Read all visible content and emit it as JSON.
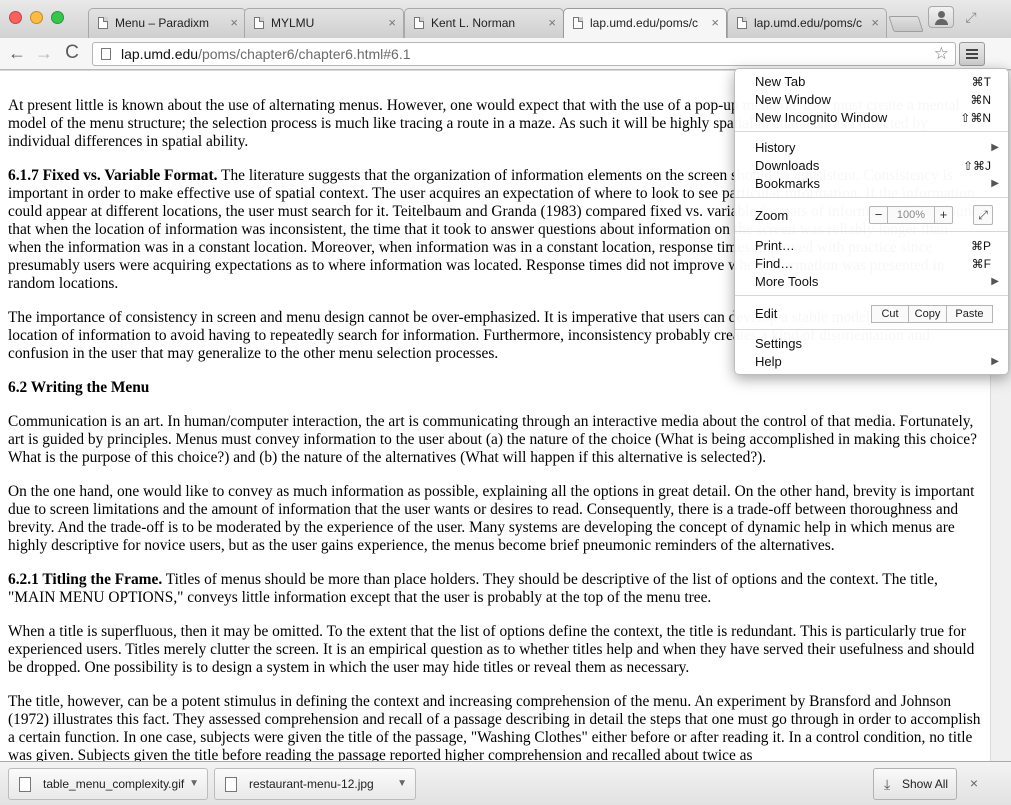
{
  "window": {
    "tabs": [
      {
        "label": "Menu – Paradixm"
      },
      {
        "label": "MYLMU"
      },
      {
        "label": "Kent L. Norman"
      },
      {
        "label": "lap.umd.edu/poms/c"
      },
      {
        "label": "lap.umd.edu/poms/c"
      }
    ]
  },
  "toolbar": {
    "back_icon": "←",
    "forward_icon": "→",
    "reload_icon": "C",
    "url_host": "lap.umd.edu",
    "url_path": "/poms/chapter6/chapter6.html#6.1",
    "star_icon": "☆"
  },
  "content": {
    "p1": "At present little is known about the use of alternating menus. However, one would expect that with the use of a pop-up menu the user must create a mental model of the menu structure; the selection process is much like tracing a route in a maze. As such it will be highly spatial in character and affected by individual differences in spatial ability.",
    "s617_heading": "6.1.7 Fixed vs. Variable Format.",
    "s617_text": " The literature suggests that the organization of information elements on the screen should be consistent. Consistency is important in order to make effective use of spatial context. The user acquires an expectation of where to look to see particular information. If the information could appear at different locations, the user must search for it. Teitelbaum and Granda (1983) compared fixed vs. variable formats of information. They found that when the location of information was inconsistent, the time that it took to answer questions about information on the screen was reliably longer than when the information was in a constant location. Moreover, when information was in a constant location, response times improved with practice since presumably users were acquiring expectations as to where information was located. Response times did not improve when information was presented in random locations.",
    "p3": "The importance of consistency in screen and menu design cannot be over-emphasized. It is imperative that users can develop a stable model of the screen and location of information to avoid having to repeatedly search for information. Furthermore, inconsistency probably creates a kind of disorientation and confusion in the user that may generalize to the other menu selection processes.",
    "h62": "6.2 Writing the Menu",
    "p4": "Communication is an art. In human/computer interaction, the art is communicating through an interactive media about the control of that media. Fortunately, art is guided by principles. Menus must convey information to the user about (a) the nature of the choice (What is being accomplished in making this choice? What is the purpose of this choice?) and (b) the nature of the alternatives (What will happen if this alternative is selected?).",
    "p5": "On the one hand, one would like to convey as much information as possible, explaining all the options in great detail. On the other hand, brevity is important due to screen limitations and the amount of information that the user wants or desires to read. Consequently, there is a trade-off between thoroughness and brevity. And the trade-off is to be moderated by the experience of the user. Many systems are developing the concept of dynamic help in which menus are highly descriptive for novice users, but as the user gains experience, the menus become brief pneumonic reminders of the alternatives.",
    "s621_heading": "6.2.1 Titling the Frame.",
    "s621_text": " Titles of menus should be more than place holders. They should be descriptive of the list of options and the context. The title, \"MAIN MENU OPTIONS,\" conveys little information except that the user is probably at the top of the menu tree.",
    "p7": "When a title is superfluous, then it may be omitted. To the extent that the list of options define the context, the title is redundant. This is particularly true for experienced users. Titles merely clutter the screen. It is an empirical question as to whether titles help and when they have served their usefulness and should be dropped. One possibility is to design a system in which the user may hide titles or reveal them as necessary.",
    "p8": "The title, however, can be a potent stimulus in defining the context and increasing comprehension of the menu. An experiment by Bransford and Johnson (1972) illustrates this fact. They assessed comprehension and recall of a passage describing in detail the steps that one must go through in order to accomplish a certain function. In one case, subjects were given the title of the passage, \"Washing Clothes\" either before or after reading it. In a control condition, no title was given. Subjects given the title before reading the passage reported higher comprehension and recalled about twice as"
  },
  "downloads": {
    "items": [
      {
        "label": "table_menu_complexity.gif"
      },
      {
        "label": "restaurant-menu-12.jpg"
      }
    ],
    "show_all": "Show All",
    "close_icon": "×"
  },
  "menu": {
    "new_tab": "New Tab",
    "new_tab_key": "⌘T",
    "new_window": "New Window",
    "new_window_key": "⌘N",
    "new_incognito": "New Incognito Window",
    "new_incognito_key": "⇧⌘N",
    "history": "History",
    "downloads": "Downloads",
    "downloads_key": "⇧⌘J",
    "bookmarks": "Bookmarks",
    "zoom": "Zoom",
    "zoom_minus": "−",
    "zoom_value": "100%",
    "zoom_plus": "+",
    "print": "Print…",
    "print_key": "⌘P",
    "find": "Find…",
    "find_key": "⌘F",
    "more_tools": "More Tools",
    "edit": "Edit",
    "cut": "Cut",
    "copy": "Copy",
    "paste": "Paste",
    "settings": "Settings",
    "help": "Help"
  }
}
